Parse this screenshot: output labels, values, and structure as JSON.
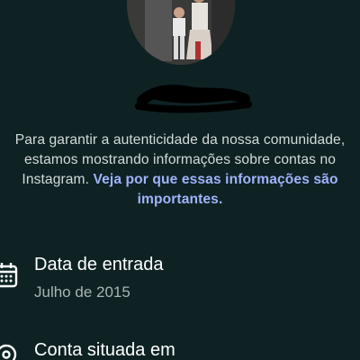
{
  "description": {
    "text": "Para garantir a autenticidade da nossa comunidade, estamos mostrando informações sobre contas no Instagram. ",
    "link": "Veja por que essas informações são importantes."
  },
  "rows": [
    {
      "title": "Data de entrada",
      "subtitle": "Julho de 2015",
      "icon": "calendar-icon"
    },
    {
      "title": "Conta situada em",
      "icon": "location-pin-icon"
    }
  ],
  "colors": {
    "background": "#0e2224",
    "link": "#9fb4f9",
    "body_text": "#d3dadb"
  }
}
